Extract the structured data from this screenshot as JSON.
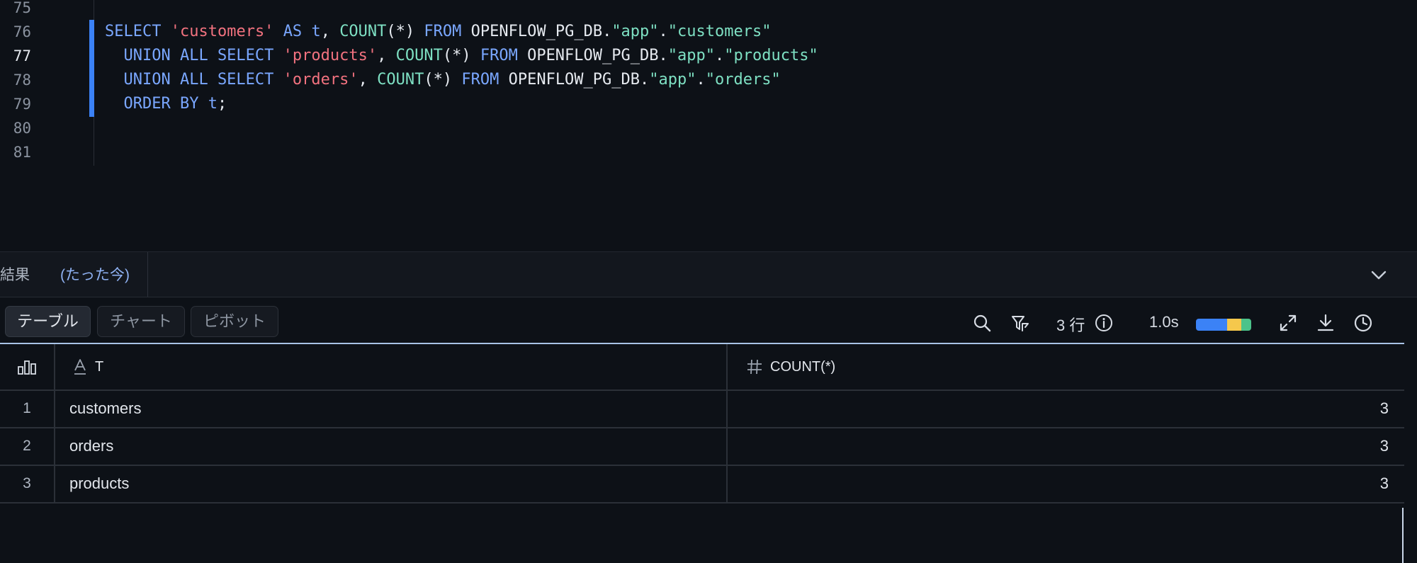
{
  "editor": {
    "line_numbers": [
      "75",
      "76",
      "77",
      "78",
      "79",
      "80",
      "81"
    ],
    "active_line": "77",
    "lines": [
      [
        {
          "t": "SELECT",
          "c": "kw"
        },
        {
          "t": " ",
          "c": "pl"
        },
        {
          "t": "'customers'",
          "c": "str"
        },
        {
          "t": " ",
          "c": "pl"
        },
        {
          "t": "AS",
          "c": "kw"
        },
        {
          "t": " ",
          "c": "pl"
        },
        {
          "t": "t",
          "c": "kw"
        },
        {
          "t": ", ",
          "c": "pl"
        },
        {
          "t": "COUNT",
          "c": "fn"
        },
        {
          "t": "(*) ",
          "c": "pl"
        },
        {
          "t": "FROM",
          "c": "kw"
        },
        {
          "t": " OPENFLOW_PG_DB.",
          "c": "pl"
        },
        {
          "t": "\"app\"",
          "c": "id"
        },
        {
          "t": ".",
          "c": "pl"
        },
        {
          "t": "\"customers\"",
          "c": "id"
        }
      ],
      [
        {
          "t": "  UNION ALL SELECT",
          "c": "kw"
        },
        {
          "t": " ",
          "c": "pl"
        },
        {
          "t": "'products'",
          "c": "str"
        },
        {
          "t": ", ",
          "c": "pl"
        },
        {
          "t": "COUNT",
          "c": "fn"
        },
        {
          "t": "(*) ",
          "c": "pl"
        },
        {
          "t": "FROM",
          "c": "kw"
        },
        {
          "t": " OPENFLOW_PG_DB.",
          "c": "pl"
        },
        {
          "t": "\"app\"",
          "c": "id"
        },
        {
          "t": ".",
          "c": "pl"
        },
        {
          "t": "\"products\"",
          "c": "id"
        }
      ],
      [
        {
          "t": "  UNION ALL SELECT",
          "c": "kw"
        },
        {
          "t": " ",
          "c": "pl"
        },
        {
          "t": "'orders'",
          "c": "str"
        },
        {
          "t": ", ",
          "c": "pl"
        },
        {
          "t": "COUNT",
          "c": "fn"
        },
        {
          "t": "(*) ",
          "c": "pl"
        },
        {
          "t": "FROM",
          "c": "kw"
        },
        {
          "t": " OPENFLOW_PG_DB.",
          "c": "pl"
        },
        {
          "t": "\"app\"",
          "c": "id"
        },
        {
          "t": ".",
          "c": "pl"
        },
        {
          "t": "\"orders\"",
          "c": "id"
        }
      ],
      [
        {
          "t": "  ORDER BY",
          "c": "kw"
        },
        {
          "t": " ",
          "c": "pl"
        },
        {
          "t": "t",
          "c": "kw"
        },
        {
          "t": ";",
          "c": "pl"
        }
      ]
    ]
  },
  "results": {
    "tab_title": "結果",
    "tab_time": "(たった今)",
    "views": [
      "テーブル",
      "チャート",
      "ピボット"
    ],
    "active_view": "テーブル",
    "row_count": "3 行",
    "duration": "1.0s",
    "timing_colors": [
      "#3b82f6",
      "#f5c84c",
      "#4cc38a"
    ],
    "timing_fractions": [
      0.56,
      0.26,
      0.18
    ],
    "columns": [
      {
        "name": "T",
        "type_icon": "text-type-icon"
      },
      {
        "name": "COUNT(*)",
        "type_icon": "number-type-icon"
      }
    ],
    "rows": [
      {
        "num": "1",
        "t": "customers",
        "count": "3"
      },
      {
        "num": "2",
        "t": "orders",
        "count": "3"
      },
      {
        "num": "3",
        "t": "products",
        "count": "3"
      }
    ]
  }
}
